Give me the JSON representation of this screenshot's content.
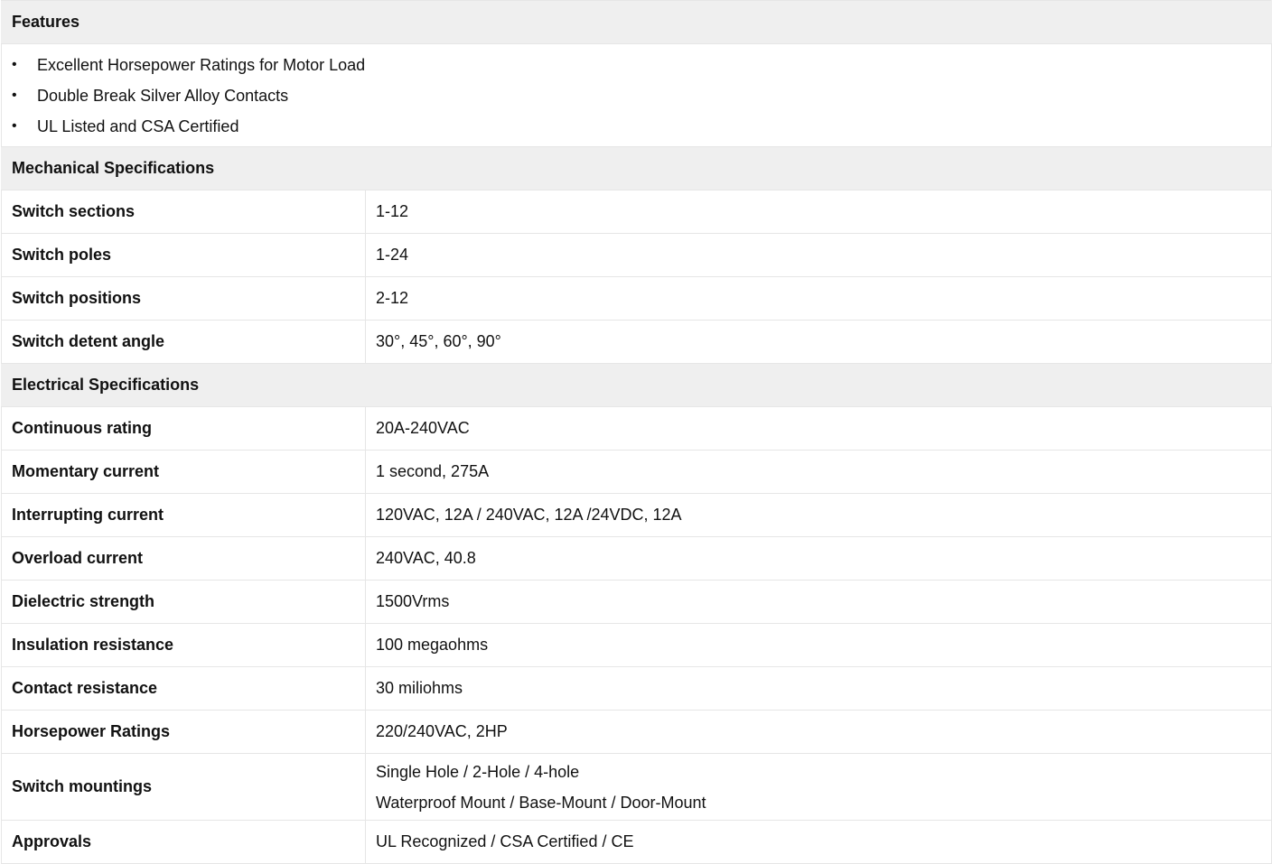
{
  "features": {
    "title": "Features",
    "items": [
      "Excellent Horsepower Ratings for Motor Load",
      "Double Break Silver Alloy Contacts",
      "UL Listed and CSA Certified"
    ]
  },
  "mechanical": {
    "title": "Mechanical Specifications",
    "rows": [
      {
        "label": "Switch sections",
        "value": "1-12"
      },
      {
        "label": "Switch poles",
        "value": "1-24"
      },
      {
        "label": "Switch positions",
        "value": "2-12"
      },
      {
        "label": "Switch detent angle",
        "value": "30°, 45°, 60°, 90°"
      }
    ]
  },
  "electrical": {
    "title": "Electrical Specifications",
    "rows": [
      {
        "label": "Continuous rating",
        "value": "20A-240VAC"
      },
      {
        "label": "Momentary current",
        "value": "1 second, 275A"
      },
      {
        "label": "Interrupting current",
        "value": "120VAC, 12A / 240VAC, 12A /24VDC, 12A"
      },
      {
        "label": "Overload current",
        "value": "240VAC, 40.8"
      },
      {
        "label": "Dielectric strength",
        "value": "1500Vrms"
      },
      {
        "label": "Insulation resistance",
        "value": "100 megaohms"
      },
      {
        "label": "Contact resistance",
        "value": "30 miliohms"
      },
      {
        "label": "Horsepower Ratings",
        "value": "220/240VAC, 2HP"
      },
      {
        "label": "Switch mountings",
        "value_line1": "Single Hole / 2-Hole / 4-hole",
        "value_line2": "Waterproof Mount / Base-Mount / Door-Mount"
      },
      {
        "label": "Approvals",
        "value": "UL Recognized / CSA Certified / CE"
      }
    ]
  },
  "bullet_char": "•"
}
